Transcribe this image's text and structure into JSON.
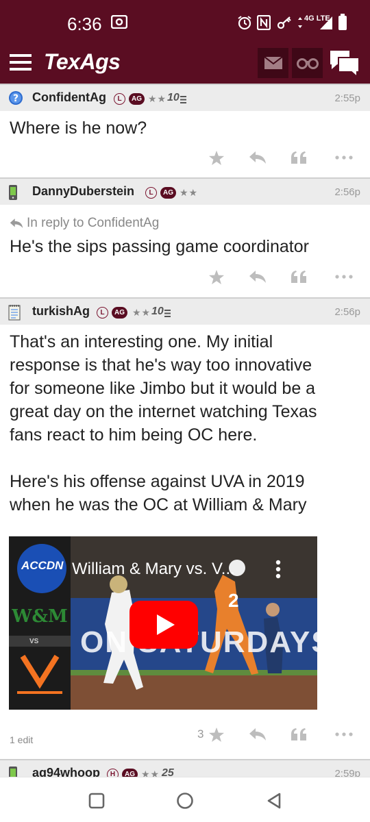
{
  "status_bar": {
    "time": "6:36",
    "network": "4G LTE"
  },
  "app": {
    "title": "TexAgs",
    "brand_color": "#5a0d22"
  },
  "posts": [
    {
      "username": "ConfidentAg",
      "avatar_icon": "question-icon",
      "badge_l": "L",
      "badge_ag": "AG",
      "stars": "★★",
      "years": "10",
      "time": "2:55p",
      "reply_to": "",
      "body": [
        "Where is he now?"
      ],
      "star_count": ""
    },
    {
      "username": "DannyDuberstein",
      "avatar_icon": "phone-icon",
      "badge_l": "L",
      "badge_ag": "AG",
      "stars": "★★",
      "years": "",
      "time": "2:56p",
      "reply_to": "In reply to ConfidentAg",
      "body": [
        "He's the sips passing game coordinator"
      ],
      "star_count": ""
    },
    {
      "username": "turkishAg",
      "avatar_icon": "notepad-icon",
      "badge_l": "L",
      "badge_ag": "AG",
      "stars": "★★",
      "years": "10",
      "time": "2:56p",
      "reply_to": "",
      "body": [
        "That's an interesting one. My initial",
        "response is that he's way too innovative",
        "for someone like Jimbo but it would be a",
        "great day on the internet watching Texas",
        "fans react to him being OC here.",
        "",
        "Here's his offense against UVA in 2019",
        "when he was the OC at William & Mary"
      ],
      "video": {
        "title": "William & Mary vs. V...",
        "channel_logo": "ACCDN",
        "side_team_top": "W&M",
        "side_vs": "VS",
        "jersey_number": "2",
        "banner_text": "ON SATURDAYS"
      },
      "star_count": "3",
      "edit_note": "1 edit"
    },
    {
      "username": "ag94whoop",
      "avatar_icon": "phone-icon",
      "badge_l": "H",
      "badge_ag": "AG",
      "stars": "★★",
      "years": "25",
      "time": "2:59p"
    }
  ]
}
